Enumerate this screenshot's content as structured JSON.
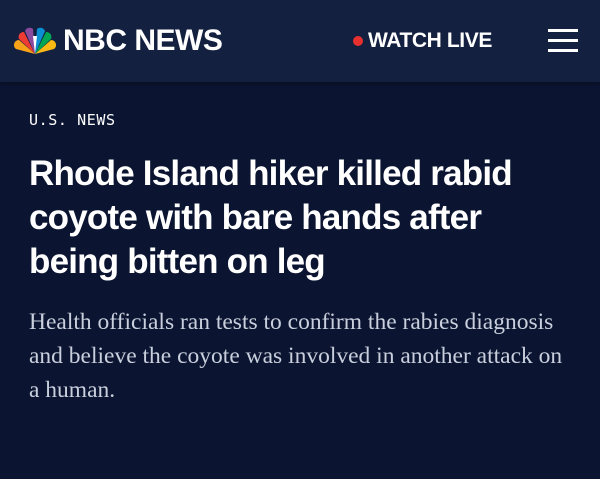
{
  "header": {
    "logo_text": "NBC NEWS",
    "logo_icon": "nbc-peacock-icon",
    "watch_live_label": "WATCH LIVE",
    "live_dot_color": "#e8312f",
    "menu_icon": "hamburger-menu-icon"
  },
  "article": {
    "section": "U.S. NEWS",
    "headline": "Rhode Island hiker killed rabid coyote with bare hands after being bitten on leg",
    "dek": "Health officials ran tests to confirm the rabies diagnosis and believe the coyote was involved in another attack on a human."
  },
  "colors": {
    "background": "#0b1532",
    "header_background": "#14203f",
    "dek_text": "#c9cfdc"
  }
}
